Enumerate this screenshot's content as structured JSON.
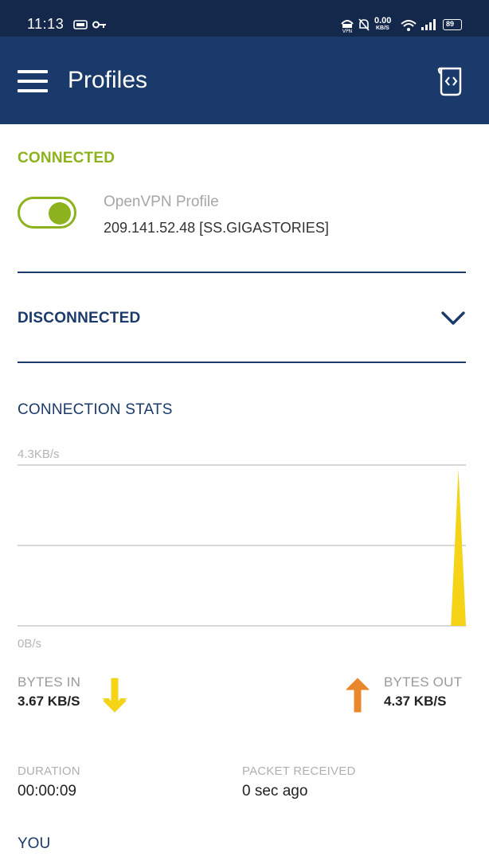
{
  "status_bar": {
    "time": "11:13",
    "data_rate": "0.00",
    "data_rate_unit": "KB/S",
    "battery": "89",
    "icons": [
      "screen-record-icon",
      "key-icon",
      "vpn-icon",
      "mute-icon",
      "wifi-icon",
      "signal-icon",
      "battery-icon"
    ]
  },
  "app_bar": {
    "title": "Profiles",
    "menu_icon": "hamburger-menu-icon",
    "action_icon": "import-profile-icon",
    "background": "#1a3a6b"
  },
  "connected": {
    "label": "CONNECTED",
    "color": "#8cb31d",
    "toggle_on": true,
    "profile_name": "OpenVPN Profile",
    "server": "209.141.52.48 [SS.GIGASTORIES]"
  },
  "disconnected": {
    "label": "DISCONNECTED",
    "chevron_icon": "chevron-down-icon"
  },
  "stats": {
    "label": "CONNECTION STATS",
    "bytes_in_label": "BYTES IN",
    "bytes_in_value": "3.67 KB/S",
    "bytes_out_label": "BYTES OUT",
    "bytes_out_value": "4.37 KB/S",
    "in_color": "#f5d316",
    "out_color": "#e8872c"
  },
  "chart_data": {
    "type": "area",
    "y_max_label": "4.3KB/s",
    "y_min_label": "0B/s",
    "ylim": [
      0,
      4.3
    ],
    "grid": true,
    "series": [
      {
        "values": [
          0,
          0,
          0,
          0,
          0,
          0,
          0,
          0,
          0,
          0,
          0,
          0,
          0,
          0,
          0,
          0,
          0,
          0,
          0,
          0,
          0,
          0,
          0,
          0,
          0,
          0,
          0,
          0,
          0,
          0,
          0,
          0,
          0,
          0,
          0,
          0,
          0,
          0,
          0,
          0,
          0,
          0,
          0,
          0,
          0,
          0,
          0,
          0,
          0,
          0,
          0,
          0,
          0,
          0,
          0,
          0,
          0,
          0,
          0,
          4.2,
          0
        ],
        "color": "#f5d316"
      }
    ]
  },
  "duration": {
    "label": "DURATION",
    "value": "00:00:09"
  },
  "packet": {
    "label": "PACKET RECEIVED",
    "value": "0 sec ago"
  },
  "you": {
    "label": "YOU"
  }
}
